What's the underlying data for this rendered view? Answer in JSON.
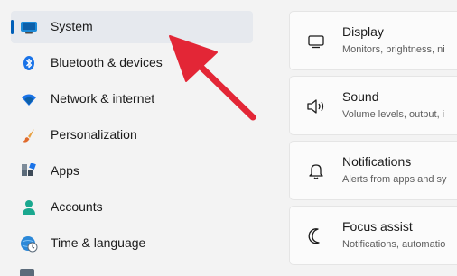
{
  "nav": {
    "items": [
      {
        "label": "System",
        "icon": "monitor-icon",
        "selected": true
      },
      {
        "label": "Bluetooth & devices",
        "icon": "bluetooth-icon"
      },
      {
        "label": "Network & internet",
        "icon": "wifi-icon"
      },
      {
        "label": "Personalization",
        "icon": "paintbrush-icon"
      },
      {
        "label": "Apps",
        "icon": "apps-icon"
      },
      {
        "label": "Accounts",
        "icon": "person-icon"
      },
      {
        "label": "Time & language",
        "icon": "globe-clock-icon"
      }
    ]
  },
  "cards": [
    {
      "title": "Display",
      "subtitle": "Monitors, brightness, ni",
      "icon": "display-icon"
    },
    {
      "title": "Sound",
      "subtitle": "Volume levels, output, i",
      "icon": "speaker-icon"
    },
    {
      "title": "Notifications",
      "subtitle": "Alerts from apps and sy",
      "icon": "bell-icon"
    },
    {
      "title": "Focus assist",
      "subtitle": "Notifications, automatio",
      "icon": "moon-icon"
    }
  ],
  "colors": {
    "accent": "#005fb8",
    "arrow": "#e32636",
    "selected_bg": "#e6e9ee"
  }
}
